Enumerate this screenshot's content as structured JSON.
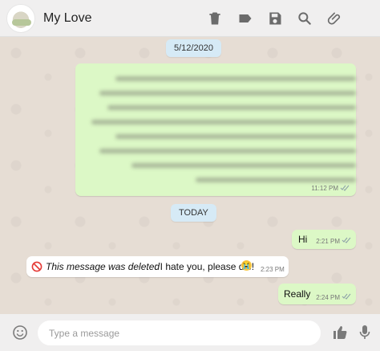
{
  "header": {
    "contact_name": "My Love",
    "icons": [
      "trash-icon",
      "label-icon",
      "save-icon",
      "search-icon",
      "attach-icon"
    ]
  },
  "chat": {
    "date_1": "5/12/2020",
    "blurred_message_time": "11:12 PM",
    "date_2": "TODAY",
    "messages": [
      {
        "direction": "out",
        "text": "Hi",
        "time": "2:21 PM"
      },
      {
        "direction": "in",
        "deleted_label": "This message was deleted",
        "text": ": I hate you, please die!",
        "emoji": "😭",
        "time": "2:23 PM"
      },
      {
        "direction": "out",
        "text": "Really",
        "time": "2:24 PM"
      }
    ]
  },
  "composer": {
    "placeholder": "Type a message"
  },
  "colors": {
    "header_bg": "#f0efef",
    "chat_bg": "#e6ddd4",
    "outgoing_bubble": "#dcf8c6",
    "incoming_bubble": "#ffffff",
    "date_pill": "#d6eaf6",
    "deleted_icon": "#e53935"
  }
}
